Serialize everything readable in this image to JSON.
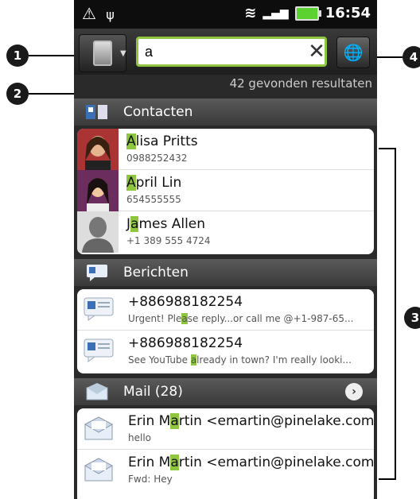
{
  "status": {
    "time": "16:54"
  },
  "search": {
    "query": "a",
    "results_count": "42 gevonden resultaten"
  },
  "sections": {
    "contacts": "Contacten",
    "messages": "Berichten",
    "mail": "Mail (28)"
  },
  "contacts": [
    {
      "pre": "",
      "hl": "A",
      "post": "lisa Pritts",
      "phone": "0988252432"
    },
    {
      "pre": "",
      "hl": "A",
      "post": "pril Lin",
      "phone": "654555555"
    },
    {
      "pre": "J",
      "hl": "a",
      "post": "mes Allen",
      "phone": "+1 389 555 4724"
    }
  ],
  "messages": [
    {
      "title": "+886988182254",
      "pre": "Urgent! Ple",
      "hl": "a",
      "post": "se reply...or call me @+1-987-65..."
    },
    {
      "title": "+886988182254",
      "pre": "See YouTube ",
      "hl": "a",
      "post": "lready in town? I'm really looki..."
    }
  ],
  "mail": [
    {
      "pre": "Erin M",
      "hl": "a",
      "post": "rtin <emartin@pinelake.com>",
      "sub": "hello"
    },
    {
      "pre": "Erin M",
      "hl": "a",
      "post": "rtin <emartin@pinelake.com>",
      "sub": "Fwd: Hey"
    }
  ],
  "callouts": [
    "1",
    "2",
    "3",
    "4"
  ],
  "colors": {
    "highlight": "#8ec63f",
    "header_bg": "#3a3a3a",
    "status_bar": "#0d0d0d"
  }
}
